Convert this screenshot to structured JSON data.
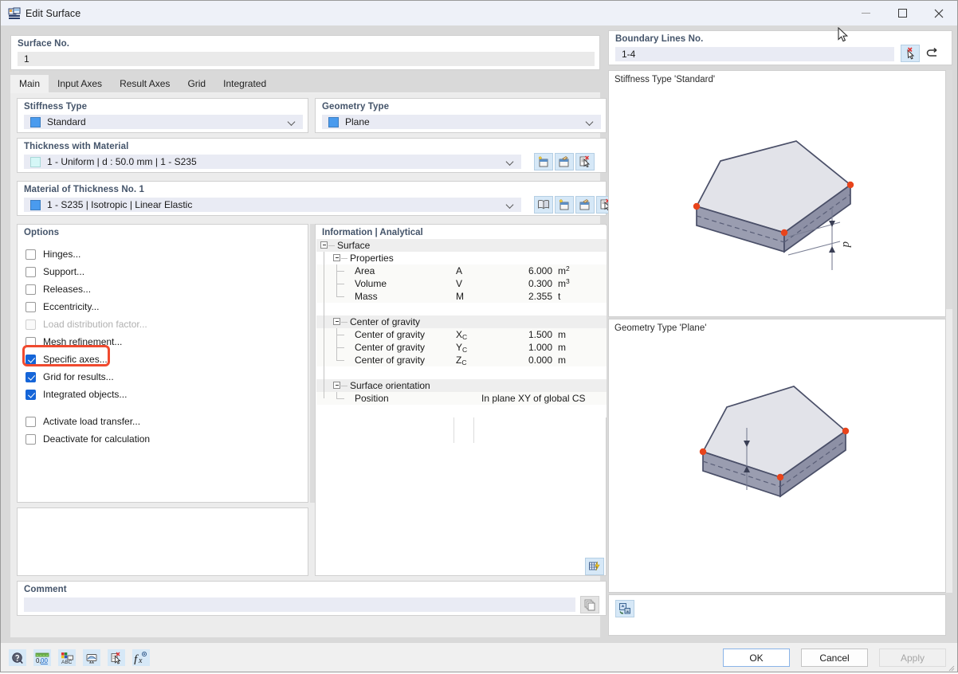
{
  "window": {
    "title": "Edit Surface",
    "icon": "edit-surface-icon",
    "controls": {
      "minimize": "minimize-icon",
      "maximize": "maximize-icon",
      "close": "close-icon"
    }
  },
  "surface_no": {
    "label": "Surface No.",
    "value": "1"
  },
  "boundary_lines": {
    "label": "Boundary Lines No.",
    "value": "1-4",
    "buttons": [
      {
        "name": "pick-lines-icon",
        "title": "Select"
      },
      {
        "name": "reverse-icon",
        "title": "Reverse"
      }
    ]
  },
  "tabs": [
    {
      "label": "Main",
      "active": true
    },
    {
      "label": "Input Axes",
      "active": false
    },
    {
      "label": "Result Axes",
      "active": false
    },
    {
      "label": "Grid",
      "active": false
    },
    {
      "label": "Integrated",
      "active": false
    }
  ],
  "stiffness_type": {
    "label": "Stiffness Type",
    "value": "Standard",
    "swatch": "#4a9bee"
  },
  "geometry_type": {
    "label": "Geometry Type",
    "value": "Plane",
    "swatch": "#4a9bee"
  },
  "thickness": {
    "label": "Thickness with Material",
    "value": "1 - Uniform | d : 50.0 mm | 1 - S235",
    "swatch": "#d5f7f7",
    "buttons": [
      "new-thickness-icon",
      "edit-thickness-icon",
      "select-thickness-icon"
    ]
  },
  "material": {
    "label": "Material of Thickness No. 1",
    "value": "1 - S235 | Isotropic | Linear Elastic",
    "swatch": "#4a9bee",
    "buttons": [
      "material-library-icon",
      "new-material-icon",
      "edit-material-icon",
      "select-material-icon"
    ]
  },
  "options": {
    "label": "Options",
    "items": [
      {
        "label": "Hinges...",
        "checked": false,
        "disabled": false,
        "gap": false
      },
      {
        "label": "Support...",
        "checked": false,
        "disabled": false,
        "gap": false
      },
      {
        "label": "Releases...",
        "checked": false,
        "disabled": false,
        "gap": false
      },
      {
        "label": "Eccentricity...",
        "checked": false,
        "disabled": false,
        "gap": false
      },
      {
        "label": "Load distribution factor...",
        "checked": false,
        "disabled": true,
        "gap": false
      },
      {
        "label": "Mesh refinement...",
        "checked": false,
        "disabled": false,
        "gap": false
      },
      {
        "label": "Specific axes...",
        "checked": true,
        "disabled": false,
        "gap": false,
        "highlighted": true
      },
      {
        "label": "Grid for results...",
        "checked": true,
        "disabled": false,
        "gap": false
      },
      {
        "label": "Integrated objects...",
        "checked": true,
        "disabled": false,
        "gap": false
      },
      {
        "label": "Activate load transfer...",
        "checked": false,
        "disabled": false,
        "gap": true
      },
      {
        "label": "Deactivate for calculation",
        "checked": false,
        "disabled": false,
        "gap": false
      }
    ]
  },
  "information": {
    "label": "Information | Analytical",
    "root": "Surface",
    "groups": [
      {
        "name": "Properties",
        "rows": [
          {
            "name": "Area",
            "symbol": "A",
            "sub": "",
            "value": "6.000",
            "unit": "m",
            "unit_sup": "2"
          },
          {
            "name": "Volume",
            "symbol": "V",
            "sub": "",
            "value": "0.300",
            "unit": "m",
            "unit_sup": "3"
          },
          {
            "name": "Mass",
            "symbol": "M",
            "sub": "",
            "value": "2.355",
            "unit": "t",
            "unit_sup": ""
          }
        ]
      },
      {
        "name": "Center of gravity",
        "rows": [
          {
            "name": "Center of gravity",
            "symbol": "X",
            "sub": "C",
            "value": "1.500",
            "unit": "m",
            "unit_sup": ""
          },
          {
            "name": "Center of gravity",
            "symbol": "Y",
            "sub": "C",
            "value": "1.000",
            "unit": "m",
            "unit_sup": ""
          },
          {
            "name": "Center of gravity",
            "symbol": "Z",
            "sub": "C",
            "value": "0.000",
            "unit": "m",
            "unit_sup": ""
          }
        ]
      },
      {
        "name": "Surface orientation",
        "rows": [
          {
            "name": "Position",
            "symbol": "",
            "sub": "",
            "value": "",
            "unit": "",
            "unit_sup": "",
            "wide_value": "In plane XY of global CS"
          }
        ]
      }
    ],
    "footer_button": "table-export-icon"
  },
  "comment": {
    "label": "Comment",
    "value": "",
    "button": "comment-copy-icon"
  },
  "preview": {
    "top_caption": "Stiffness Type 'Standard'",
    "bottom_caption": "Geometry Type 'Plane'",
    "thickness_symbol": "d",
    "tool_button": "render-settings-icon"
  },
  "bottom_bar": {
    "icons": [
      "help-icon",
      "units-icon",
      "display-properties-icon",
      "visual-icon",
      "select-icon",
      "formula-icon"
    ],
    "buttons": [
      {
        "label": "OK",
        "state": "default"
      },
      {
        "label": "Cancel",
        "state": "normal"
      },
      {
        "label": "Apply",
        "state": "disabled"
      }
    ]
  },
  "colors": {
    "accent": "#44546a",
    "highlight": "#f04a2f",
    "checkbox_checked": "#1565d8",
    "field_bg": "#e9ebf4",
    "titlebar_bg": "#eef1f8"
  }
}
